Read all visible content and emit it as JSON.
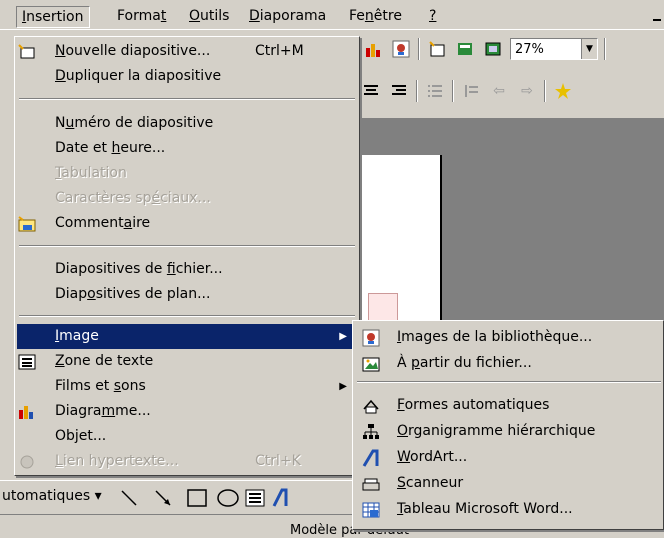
{
  "menubar": {
    "items": [
      {
        "label_pre": "",
        "label_u": "I",
        "label_post": "nsertion"
      },
      {
        "label_pre": "Forma",
        "label_u": "t",
        "label_post": ""
      },
      {
        "label_pre": "",
        "label_u": "O",
        "label_post": "utils"
      },
      {
        "label_pre": "",
        "label_u": "D",
        "label_post": "iaporama"
      },
      {
        "label_pre": "Fe",
        "label_u": "n",
        "label_post": "être"
      },
      {
        "label_pre": "",
        "label_u": "?",
        "label_post": ""
      }
    ]
  },
  "toolbar": {
    "zoom": "27%"
  },
  "insert_menu": {
    "items": [
      {
        "pre": "",
        "u": "N",
        "post": "ouvelle diapositive...",
        "shortcut": "Ctrl+M"
      },
      {
        "pre": "",
        "u": "D",
        "post": "upliquer la diapositive"
      },
      {
        "pre": "N",
        "u": "u",
        "post": "méro de diapositive"
      },
      {
        "pre": "Date et ",
        "u": "h",
        "post": "eure..."
      },
      {
        "pre": "",
        "u": "T",
        "post": "abulation"
      },
      {
        "pre": "Caractères sp",
        "u": "é",
        "post": "ciaux..."
      },
      {
        "pre": "Comment",
        "u": "a",
        "post": "ire"
      },
      {
        "pre": "Diapositives de ",
        "u": "f",
        "post": "ichier..."
      },
      {
        "pre": "Diap",
        "u": "o",
        "post": "sitives de plan..."
      },
      {
        "pre": "",
        "u": "I",
        "post": "mage"
      },
      {
        "pre": "",
        "u": "Z",
        "post": "one de texte"
      },
      {
        "pre": "Films et ",
        "u": "s",
        "post": "ons"
      },
      {
        "pre": "Diagra",
        "u": "m",
        "post": "me..."
      },
      {
        "pre": "Ob",
        "u": "j",
        "post": "et..."
      },
      {
        "pre": "",
        "u": "L",
        "post": "ien hypertexte...",
        "shortcut": "Ctrl+K"
      }
    ]
  },
  "image_submenu": {
    "items": [
      {
        "pre": "",
        "u": "I",
        "post": "mages de la bibliothèque..."
      },
      {
        "pre": "À ",
        "u": "p",
        "post": "artir du fichier..."
      },
      {
        "pre": "",
        "u": "F",
        "post": "ormes automatiques"
      },
      {
        "pre": "",
        "u": "O",
        "post": "rganigramme hiérarchique"
      },
      {
        "pre": "",
        "u": "W",
        "post": "ordArt..."
      },
      {
        "pre": "",
        "u": "S",
        "post": "canneur"
      },
      {
        "pre": "",
        "u": "T",
        "post": "ableau Microsoft Word..."
      }
    ]
  },
  "drawing_toolbar": {
    "autoshapes_label": "utomatiques ▾"
  },
  "status_bar": {
    "design_text": "Modèle par défaut"
  },
  "colors": {
    "highlight": "#0a246a",
    "face": "#d4d0c8",
    "disabled": "#a6a29a"
  }
}
